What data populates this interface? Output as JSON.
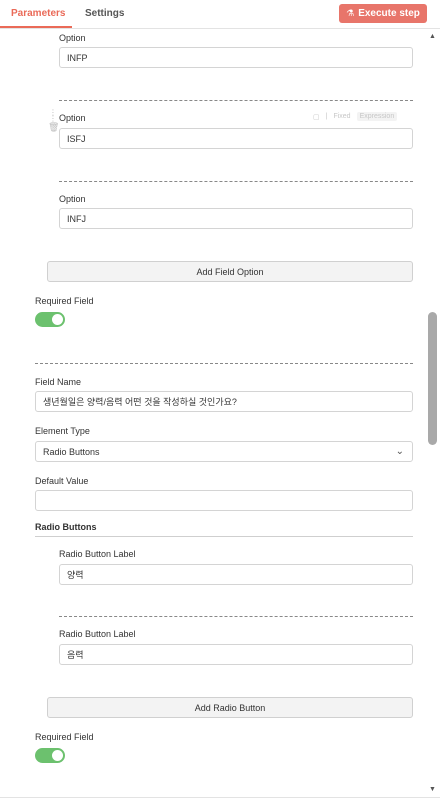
{
  "tabs": {
    "parameters": "Parameters",
    "settings": "Settings"
  },
  "execute_button": "Execute step",
  "options": [
    {
      "label": "Option",
      "value": "INFP"
    },
    {
      "label": "Option",
      "value": "ISFJ"
    },
    {
      "label": "Option",
      "value": "INFJ"
    }
  ],
  "option_hover": {
    "fixed": "Fixed",
    "expression": "Expression"
  },
  "add_field_option": "Add Field Option",
  "required_field_1": {
    "label": "Required Field",
    "on": true
  },
  "field_name": {
    "label": "Field Name",
    "value": "생년월일은 양력/음력 어떤 것을 작성하실 것인가요?"
  },
  "element_type": {
    "label": "Element Type",
    "value": "Radio Buttons"
  },
  "default_value": {
    "label": "Default Value",
    "value": ""
  },
  "radio_section": {
    "title": "Radio Buttons",
    "items": [
      {
        "label": "Radio Button Label",
        "value": "양력"
      },
      {
        "label": "Radio Button Label",
        "value": "음력"
      }
    ],
    "add_button": "Add Radio Button"
  },
  "required_field_2": {
    "label": "Required Field",
    "on": true
  },
  "colors": {
    "accent": "#ea6a58",
    "toggle_on": "#6cc16e"
  }
}
